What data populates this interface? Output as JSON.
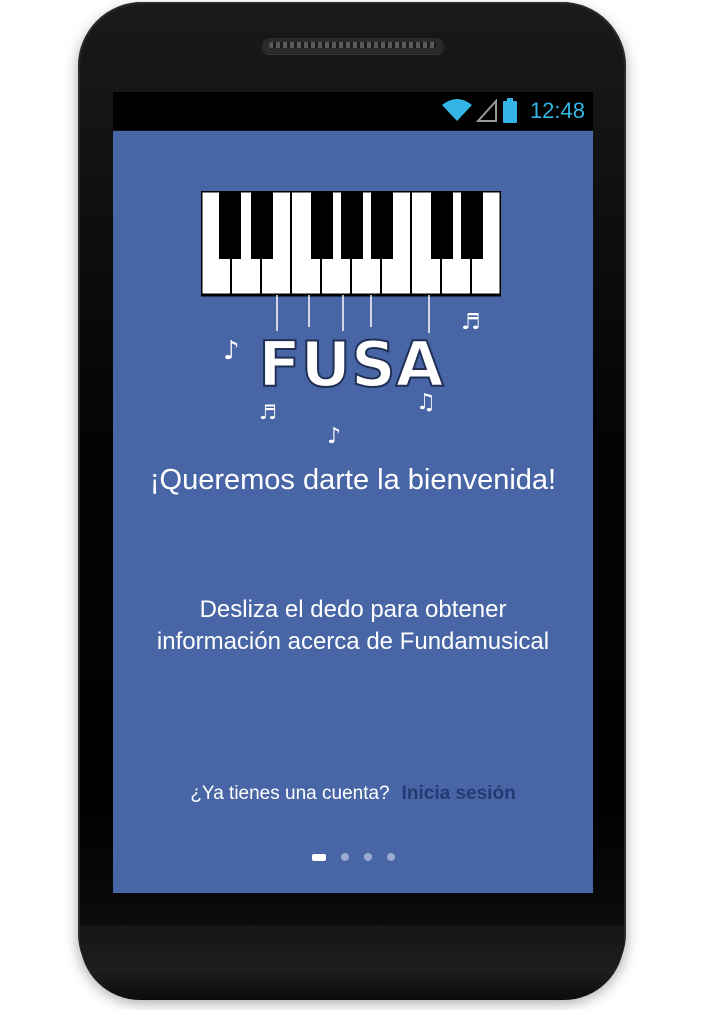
{
  "status_bar": {
    "time": "12:48",
    "icons": [
      "wifi-icon",
      "signal-icon",
      "battery-icon"
    ],
    "accent": "#33b5e5"
  },
  "logo": {
    "text": "FUSA"
  },
  "welcome": {
    "headline": "¡Queremos darte la bienvenida!",
    "subtext": "Desliza el dedo para obtener información acerca de Fundamusical"
  },
  "account": {
    "question": "¿Ya tienes una cuenta?",
    "login_label": "Inicia sesión"
  },
  "pager": {
    "total_pages": 4,
    "current_page": 1
  },
  "colors": {
    "background": "#4866a6",
    "link": "#243a73"
  }
}
